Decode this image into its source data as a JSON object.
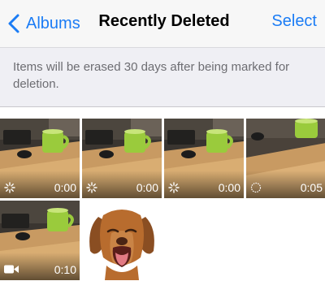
{
  "nav": {
    "back_label": "Albums",
    "title": "Recently Deleted",
    "select_label": "Select",
    "accent": "#1b7cf5"
  },
  "banner": {
    "text": "Items will be erased 30 days after being marked for deletion."
  },
  "items": [
    {
      "type": "video",
      "duration": "0:00",
      "badge_icon": "loading-spinner-icon"
    },
    {
      "type": "video",
      "duration": "0:00",
      "badge_icon": "loading-spinner-icon"
    },
    {
      "type": "video",
      "duration": "0:00",
      "badge_icon": "loading-spinner-icon"
    },
    {
      "type": "video",
      "duration": "0:05",
      "badge_icon": "progress-ring-icon"
    },
    {
      "type": "video",
      "duration": "0:10",
      "badge_icon": "video-camera-icon"
    },
    {
      "type": "photo",
      "subject": "puppy-photo"
    }
  ]
}
